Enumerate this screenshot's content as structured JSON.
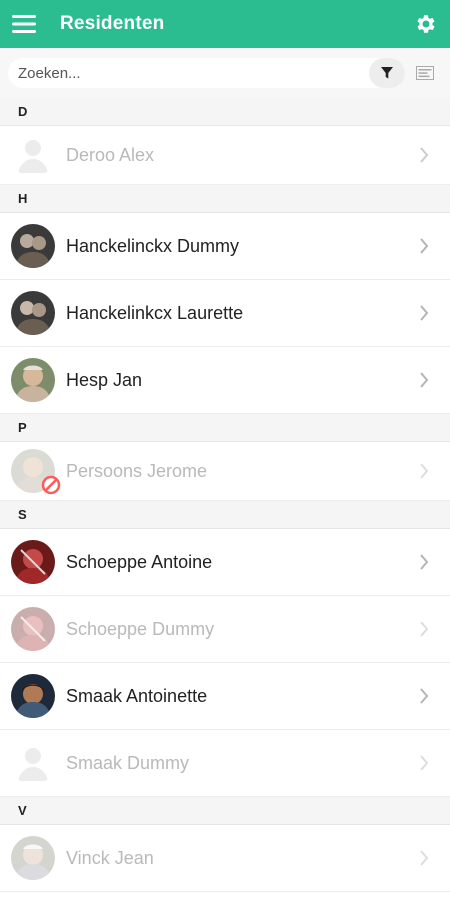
{
  "app": {
    "title": "Residenten"
  },
  "search": {
    "placeholder": "Zoeken..."
  },
  "colors": {
    "accent": "#2bbd8f",
    "blocked": "#ff5a5a"
  },
  "sections": [
    {
      "letter": "D",
      "residents": [
        {
          "name": "Deroo Alex",
          "active": false,
          "avatar": "placeholder"
        }
      ]
    },
    {
      "letter": "H",
      "residents": [
        {
          "name": "Hanckelinckx Dummy",
          "active": true,
          "avatar": "photo-elderly-couple"
        },
        {
          "name": "Hanckelinkcx Laurette",
          "active": true,
          "avatar": "photo-elderly-couple"
        },
        {
          "name": "Hesp Jan",
          "active": true,
          "avatar": "photo-man"
        }
      ]
    },
    {
      "letter": "P",
      "residents": [
        {
          "name": "Persoons Jerome",
          "active": false,
          "avatar": "photo-man-blocked"
        }
      ]
    },
    {
      "letter": "S",
      "residents": [
        {
          "name": "Schoeppe Antoine",
          "active": true,
          "avatar": "photo-red"
        },
        {
          "name": "Schoeppe Dummy",
          "active": false,
          "avatar": "photo-red"
        },
        {
          "name": "Smaak Antoinette",
          "active": true,
          "avatar": "photo-woman"
        },
        {
          "name": "Smaak Dummy",
          "active": false,
          "avatar": "placeholder"
        }
      ]
    },
    {
      "letter": "V",
      "residents": [
        {
          "name": "Vinck Jean",
          "active": false,
          "avatar": "photo-man"
        }
      ]
    }
  ]
}
